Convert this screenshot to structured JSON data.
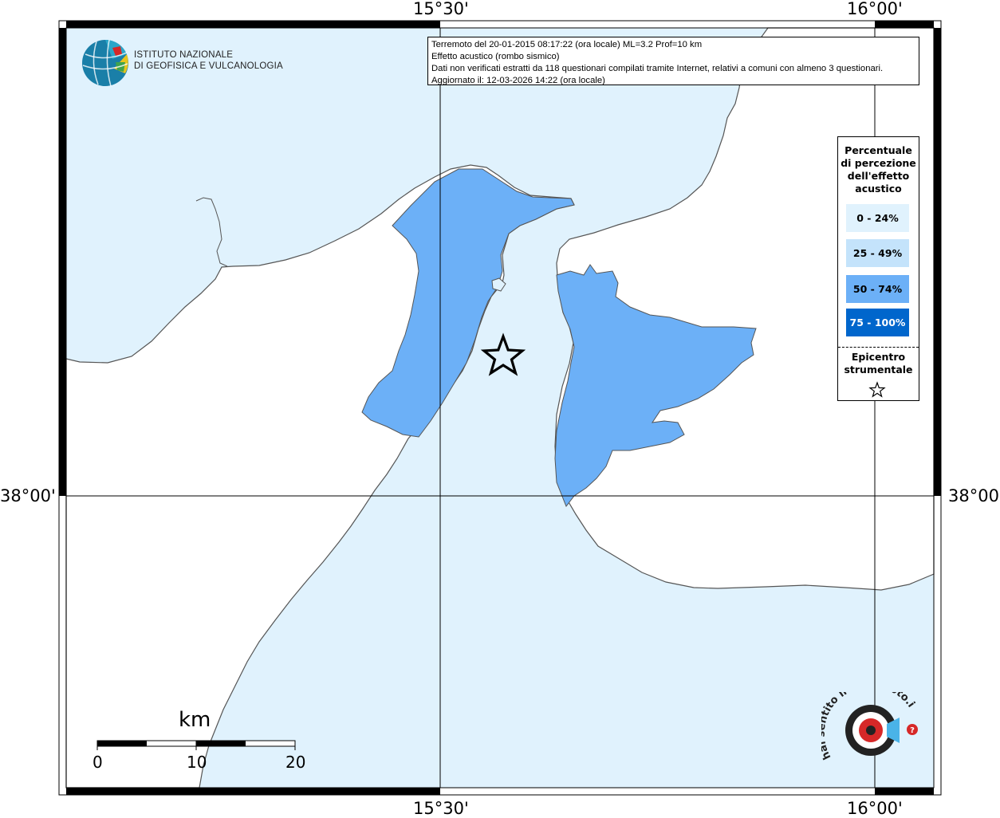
{
  "map": {
    "colors": {
      "sea": "#e0f2fd",
      "land": "#ffffff",
      "coast": "#555555",
      "class_0_24": "#e0f2fd",
      "class_25_49": "#c4e3fb",
      "class_50_74": "#6cb0f7",
      "class_75_100": "#0066cc"
    },
    "top_labels": [
      "15°30'",
      "16°00'"
    ],
    "bottom_labels": [
      "15°30'",
      "16°00'"
    ],
    "left_labels": [
      "38°00'"
    ],
    "right_labels": [
      "38°00'"
    ]
  },
  "info": {
    "line1": "Terremoto del 20-01-2015 08:17:22 (ora locale) ML=3.2 Prof=10 km",
    "line2": "Effetto acustico (rombo sismico)",
    "line3": "Dati non verificati estratti da 118 questionari compilati tramite Internet, relativi a comuni con almeno 3 questionari.",
    "line4": "Aggiornato il: 12-03-2026 14:22 (ora locale)"
  },
  "logo": {
    "line1": "ISTITUTO NAZIONALE",
    "line2": "DI GEOFISICA E VULCANOLOGIA"
  },
  "legend": {
    "title_lines": [
      "Percentuale",
      "di percezione",
      "dell'effetto",
      "acustico"
    ],
    "classes": [
      {
        "label": "0 - 24%",
        "color": "#e0f2fd",
        "text_color": "#000000"
      },
      {
        "label": "25 - 49%",
        "color": "#c4e3fb",
        "text_color": "#000000"
      },
      {
        "label": "50 - 74%",
        "color": "#6cb0f7",
        "text_color": "#000000"
      },
      {
        "label": "75 - 100%",
        "color": "#0066cc",
        "text_color": "#ffffff"
      }
    ],
    "epicenter_lines": [
      "Epicentro",
      "strumentale"
    ],
    "epicenter_icon": "star-outline-icon"
  },
  "scale": {
    "title": "km",
    "ticks": [
      "0",
      "10",
      "20"
    ]
  },
  "watermark": {
    "text": "hai sentito il terremoto.it",
    "icon": "speaker-target-icon"
  }
}
